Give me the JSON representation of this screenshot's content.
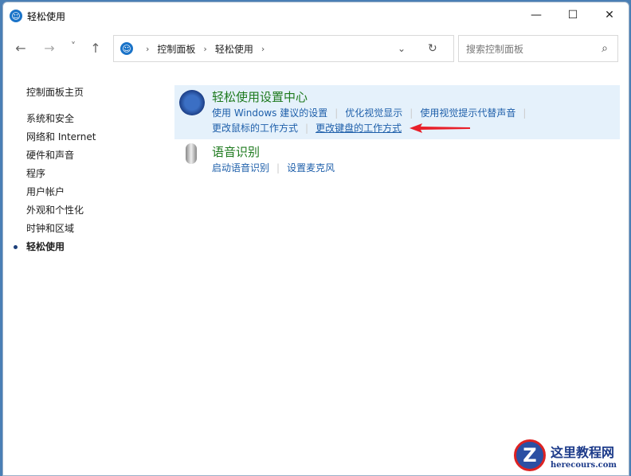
{
  "window": {
    "title": "轻松使用",
    "minimize": "—",
    "maximize": "☐",
    "close": "✕"
  },
  "nav": {
    "back": "←",
    "forward": "→",
    "recent": "˅",
    "up": "↑",
    "breadcrumb": [
      "控制面板",
      "轻松使用"
    ],
    "dropdown": "⌄",
    "refresh": "↻",
    "search_placeholder": "搜索控制面板",
    "search_icon": "⌕"
  },
  "sidebar": {
    "home": "控制面板主页",
    "items": [
      "系统和安全",
      "网络和 Internet",
      "硬件和声音",
      "程序",
      "用户帐户",
      "外观和个性化",
      "时钟和区域",
      "轻松使用"
    ]
  },
  "categories": [
    {
      "title": "轻松使用设置中心",
      "links": [
        "使用 Windows 建议的设置",
        "优化视觉显示",
        "使用视觉提示代替声音",
        "更改鼠标的工作方式",
        "更改键盘的工作方式"
      ]
    },
    {
      "title": "语音识别",
      "links": [
        "启动语音识别",
        "设置麦克风"
      ]
    }
  ],
  "watermark": {
    "name": "这里教程网",
    "url": "herecours.com"
  },
  "colors": {
    "accent": "#1e5faa",
    "heading": "#1e7a1e",
    "highlight": "#e5f1fb",
    "arrow": "#e8202a"
  }
}
